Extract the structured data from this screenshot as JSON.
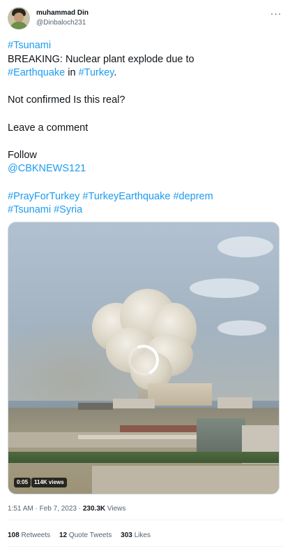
{
  "author": {
    "display_name": "muhammad Din",
    "handle": "@Dinbaloch231",
    "more_icon": "more-options-icon"
  },
  "tweet": {
    "line1": "#Tsunami",
    "line2_prefix": "BREAKING: Nuclear plant explode due to",
    "line3_tag1": "#Earthquake",
    "line3_mid": " in ",
    "line3_tag2": "#Turkey",
    "line3_suffix": ".",
    "line5": "Not confirmed Is this real?",
    "line7": "Leave a comment",
    "line9": "Follow",
    "line10_mention": "@CBKNEWS121",
    "hashtags_line1": "#PrayForTurkey #TurkeyEarthquake #deprem",
    "hashtags_line2": "#Tsunami #Syria"
  },
  "video": {
    "time": "0:05",
    "views": "114K views",
    "spinner_icon": "loading-spinner-icon"
  },
  "meta": {
    "time": "1:51 AM",
    "separator": " · ",
    "date": "Feb 7, 2023",
    "views_count": "230.3K",
    "views_label": " Views"
  },
  "stats": {
    "retweets_count": "108",
    "retweets_label": " Retweets",
    "quotes_count": "12",
    "quotes_label": " Quote Tweets",
    "likes_count": "303",
    "likes_label": " Likes"
  },
  "colors": {
    "link": "#1d9bf0",
    "text": "#0f1419",
    "secondary": "#536471"
  }
}
